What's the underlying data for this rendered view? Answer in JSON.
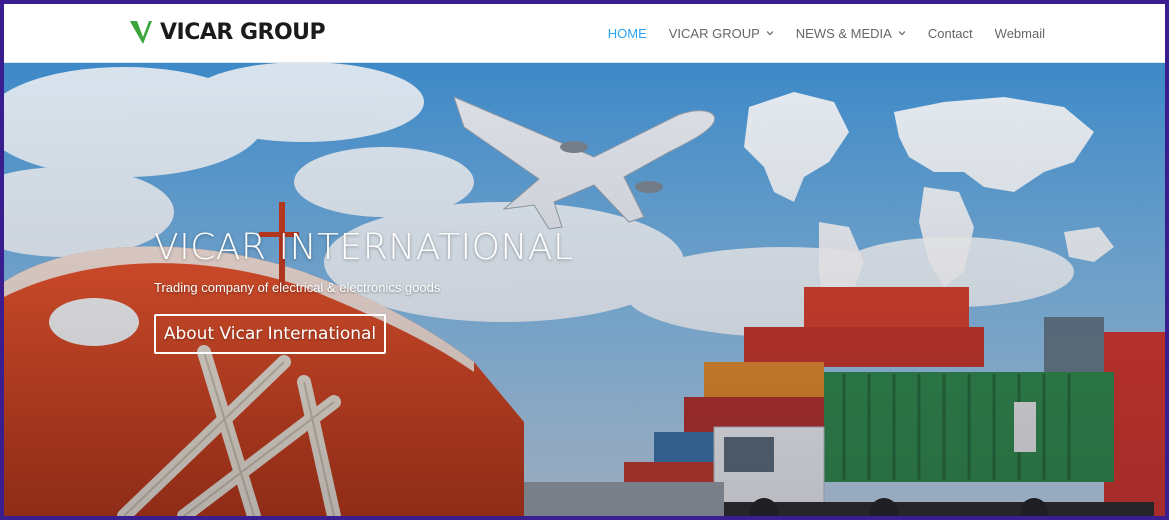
{
  "brand": {
    "logo_text": "VICAR GROUP",
    "accent": "#2ea3f2",
    "logo_green": "#3aa63c"
  },
  "nav": {
    "items": [
      {
        "label": "HOME",
        "active": true,
        "dropdown": false
      },
      {
        "label": "VICAR GROUP",
        "active": false,
        "dropdown": true
      },
      {
        "label": "NEWS & MEDIA",
        "active": false,
        "dropdown": true
      },
      {
        "label": "Contact",
        "active": false,
        "dropdown": false
      },
      {
        "label": "Webmail",
        "active": false,
        "dropdown": false
      }
    ]
  },
  "hero": {
    "title": "VICAR INTERNATIONAL",
    "subtitle": "Trading company of electrical & electronics goods",
    "button_label": "About Vicar International"
  }
}
